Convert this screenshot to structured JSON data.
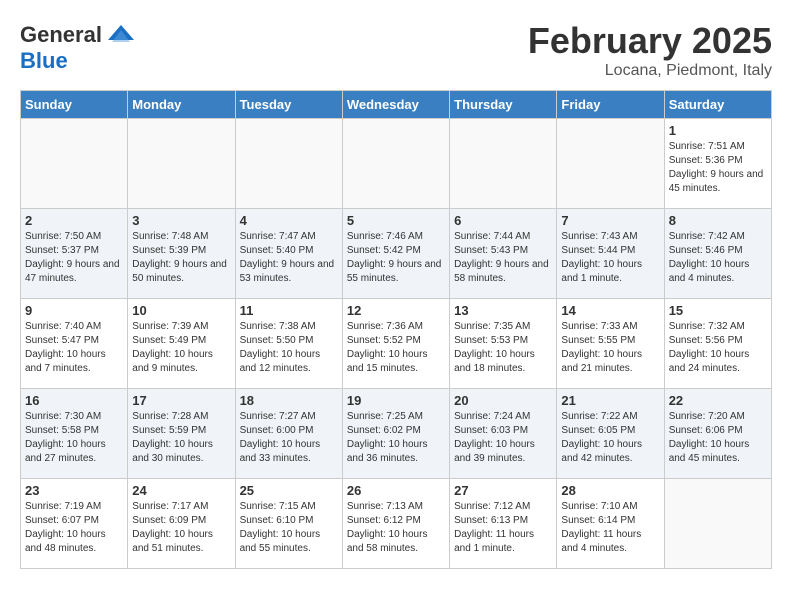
{
  "header": {
    "logo_general": "General",
    "logo_blue": "Blue",
    "month_title": "February 2025",
    "location": "Locana, Piedmont, Italy"
  },
  "days_of_week": [
    "Sunday",
    "Monday",
    "Tuesday",
    "Wednesday",
    "Thursday",
    "Friday",
    "Saturday"
  ],
  "weeks": [
    {
      "days": [
        {
          "num": "",
          "info": ""
        },
        {
          "num": "",
          "info": ""
        },
        {
          "num": "",
          "info": ""
        },
        {
          "num": "",
          "info": ""
        },
        {
          "num": "",
          "info": ""
        },
        {
          "num": "",
          "info": ""
        },
        {
          "num": "1",
          "info": "Sunrise: 7:51 AM\nSunset: 5:36 PM\nDaylight: 9 hours and 45 minutes."
        }
      ]
    },
    {
      "days": [
        {
          "num": "2",
          "info": "Sunrise: 7:50 AM\nSunset: 5:37 PM\nDaylight: 9 hours and 47 minutes."
        },
        {
          "num": "3",
          "info": "Sunrise: 7:48 AM\nSunset: 5:39 PM\nDaylight: 9 hours and 50 minutes."
        },
        {
          "num": "4",
          "info": "Sunrise: 7:47 AM\nSunset: 5:40 PM\nDaylight: 9 hours and 53 minutes."
        },
        {
          "num": "5",
          "info": "Sunrise: 7:46 AM\nSunset: 5:42 PM\nDaylight: 9 hours and 55 minutes."
        },
        {
          "num": "6",
          "info": "Sunrise: 7:44 AM\nSunset: 5:43 PM\nDaylight: 9 hours and 58 minutes."
        },
        {
          "num": "7",
          "info": "Sunrise: 7:43 AM\nSunset: 5:44 PM\nDaylight: 10 hours and 1 minute."
        },
        {
          "num": "8",
          "info": "Sunrise: 7:42 AM\nSunset: 5:46 PM\nDaylight: 10 hours and 4 minutes."
        }
      ]
    },
    {
      "days": [
        {
          "num": "9",
          "info": "Sunrise: 7:40 AM\nSunset: 5:47 PM\nDaylight: 10 hours and 7 minutes."
        },
        {
          "num": "10",
          "info": "Sunrise: 7:39 AM\nSunset: 5:49 PM\nDaylight: 10 hours and 9 minutes."
        },
        {
          "num": "11",
          "info": "Sunrise: 7:38 AM\nSunset: 5:50 PM\nDaylight: 10 hours and 12 minutes."
        },
        {
          "num": "12",
          "info": "Sunrise: 7:36 AM\nSunset: 5:52 PM\nDaylight: 10 hours and 15 minutes."
        },
        {
          "num": "13",
          "info": "Sunrise: 7:35 AM\nSunset: 5:53 PM\nDaylight: 10 hours and 18 minutes."
        },
        {
          "num": "14",
          "info": "Sunrise: 7:33 AM\nSunset: 5:55 PM\nDaylight: 10 hours and 21 minutes."
        },
        {
          "num": "15",
          "info": "Sunrise: 7:32 AM\nSunset: 5:56 PM\nDaylight: 10 hours and 24 minutes."
        }
      ]
    },
    {
      "days": [
        {
          "num": "16",
          "info": "Sunrise: 7:30 AM\nSunset: 5:58 PM\nDaylight: 10 hours and 27 minutes."
        },
        {
          "num": "17",
          "info": "Sunrise: 7:28 AM\nSunset: 5:59 PM\nDaylight: 10 hours and 30 minutes."
        },
        {
          "num": "18",
          "info": "Sunrise: 7:27 AM\nSunset: 6:00 PM\nDaylight: 10 hours and 33 minutes."
        },
        {
          "num": "19",
          "info": "Sunrise: 7:25 AM\nSunset: 6:02 PM\nDaylight: 10 hours and 36 minutes."
        },
        {
          "num": "20",
          "info": "Sunrise: 7:24 AM\nSunset: 6:03 PM\nDaylight: 10 hours and 39 minutes."
        },
        {
          "num": "21",
          "info": "Sunrise: 7:22 AM\nSunset: 6:05 PM\nDaylight: 10 hours and 42 minutes."
        },
        {
          "num": "22",
          "info": "Sunrise: 7:20 AM\nSunset: 6:06 PM\nDaylight: 10 hours and 45 minutes."
        }
      ]
    },
    {
      "days": [
        {
          "num": "23",
          "info": "Sunrise: 7:19 AM\nSunset: 6:07 PM\nDaylight: 10 hours and 48 minutes."
        },
        {
          "num": "24",
          "info": "Sunrise: 7:17 AM\nSunset: 6:09 PM\nDaylight: 10 hours and 51 minutes."
        },
        {
          "num": "25",
          "info": "Sunrise: 7:15 AM\nSunset: 6:10 PM\nDaylight: 10 hours and 55 minutes."
        },
        {
          "num": "26",
          "info": "Sunrise: 7:13 AM\nSunset: 6:12 PM\nDaylight: 10 hours and 58 minutes."
        },
        {
          "num": "27",
          "info": "Sunrise: 7:12 AM\nSunset: 6:13 PM\nDaylight: 11 hours and 1 minute."
        },
        {
          "num": "28",
          "info": "Sunrise: 7:10 AM\nSunset: 6:14 PM\nDaylight: 11 hours and 4 minutes."
        },
        {
          "num": "",
          "info": ""
        }
      ]
    }
  ]
}
